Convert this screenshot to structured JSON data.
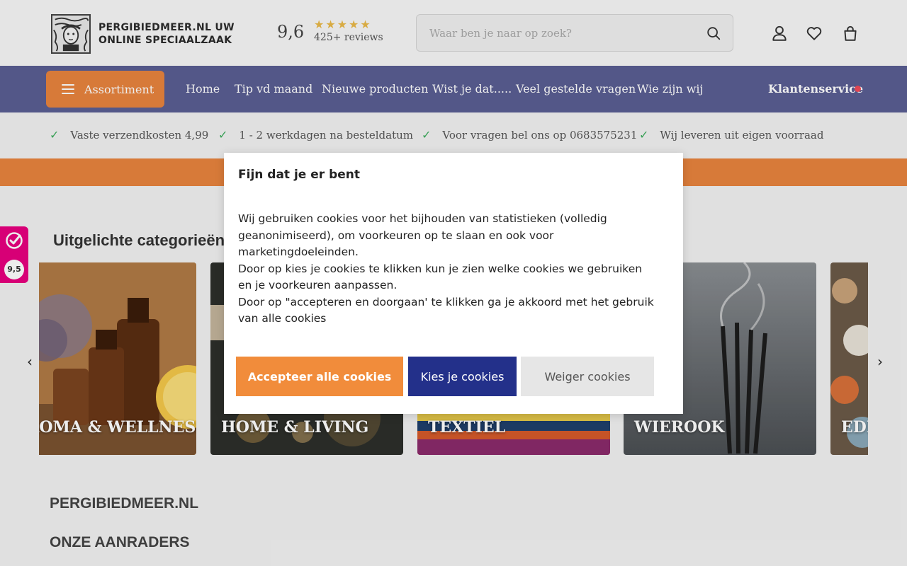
{
  "header": {
    "logo_text": "PERGIBIEDMEER.NL UW ONLINE SPECIAALZAAK",
    "rating": {
      "score": "9,6",
      "stars": 5,
      "reviews": "425+ reviews",
      "star_color": "#e9b949"
    },
    "search": {
      "placeholder": "Waar ben je naar op zoek?",
      "value": ""
    },
    "icons": [
      "search-icon",
      "user-icon",
      "heart-icon",
      "bag-icon"
    ]
  },
  "nav": {
    "background": "#5a5e93",
    "assortiment_label": "Assortiment",
    "links": [
      "Home",
      "Tip vd maand",
      "Nieuwe producten",
      "Wist je dat.....",
      "Veel gestelde vragen",
      "Wie zijn wij"
    ],
    "klantenservice": "Klantenservice",
    "accent": "#e8843e"
  },
  "usp": [
    "Vaste verzendkosten 4,99",
    "1 - 2 werkdagen na besteldatum",
    "Voor vragen bel ons op 0683575231",
    "Wij leveren uit eigen voorraad"
  ],
  "content": {
    "featured_title": "Uitgelichte categorieën",
    "categories": [
      "AROMA & WELLNESS",
      "HOME & LIVING",
      "TEXTIEL",
      "WIEROOK",
      "EDELSTENEN"
    ],
    "heading_site": "PERGIBIEDMEER.NL",
    "heading_recommend": "ONZE AANRADERS"
  },
  "side_badge": {
    "score": "9,5",
    "color": "#e8007f"
  },
  "cookie_modal": {
    "title": "Fijn dat je er bent",
    "paragraphs": [
      "Wij gebruiken cookies voor het bijhouden van statistieken (volledig geanonimiseerd), om voorkeuren op te slaan en ook voor marketingdoeleinden.",
      "Door op kies je cookies te klikken kun je zien welke cookies we gebruiken en je voorkeuren aanpassen.",
      "Door op \"accepteren en doorgaan' te klikken ga je akkoord met het gebruik van alle cookies"
    ],
    "accept_label": "Accepteer alle cookies",
    "choose_label": "Kies je cookies",
    "reject_label": "Weiger cookies",
    "accept_color": "#f18c3b",
    "choose_color": "#23308a"
  }
}
